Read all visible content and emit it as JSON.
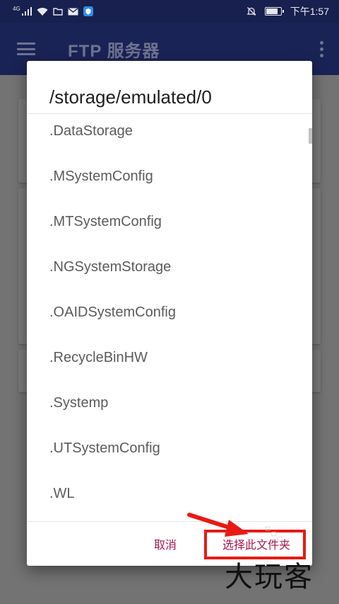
{
  "status_bar": {
    "network": "4G",
    "time": "下午1:57"
  },
  "app_bar": {
    "title": "FTP 服务器",
    "menu_icon": "hamburger-menu-icon",
    "overflow_icon": "more-vert-icon"
  },
  "dialog": {
    "title": "/storage/emulated/0",
    "folders": [
      ".DataStorage",
      ".MSystemConfig",
      ".MTSystemConfig",
      ".NGSystemStorage",
      ".OAIDSystemConfig",
      ".RecycleBinHW",
      ".Systemp",
      ".UTSystemConfig",
      ".WL"
    ],
    "cancel_label": "取消",
    "select_label": "选择此文件夹"
  },
  "watermark": {
    "text": "大玩客"
  },
  "colors": {
    "app_bar": "#1a2356",
    "status_bar": "#17204e",
    "accent": "#a8154f",
    "annotation": "#e81a14"
  }
}
